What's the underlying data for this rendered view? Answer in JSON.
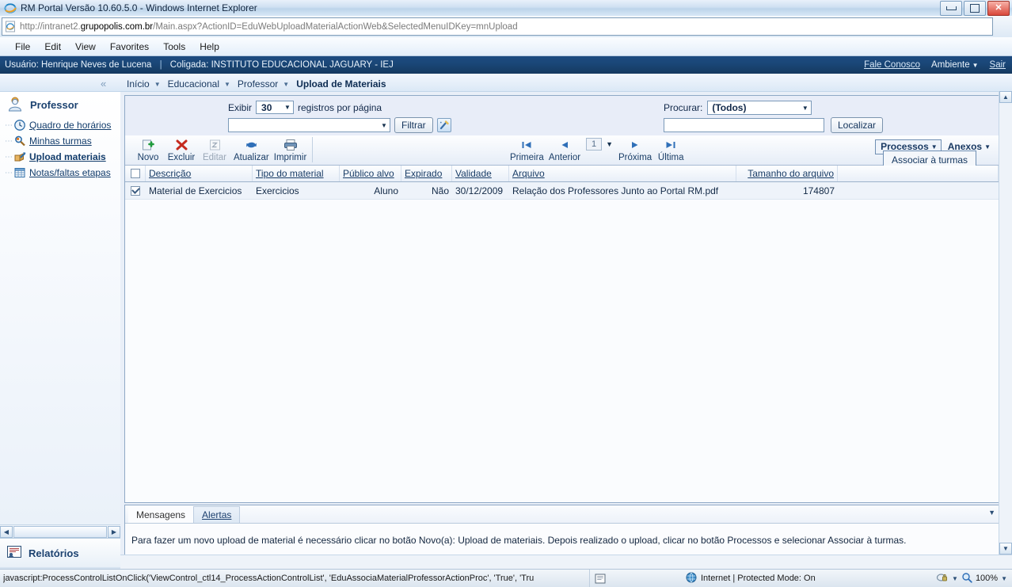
{
  "window": {
    "title": "RM Portal Versão 10.60.5.0 - Windows Internet Explorer",
    "minimize_label": "Minimize",
    "maximize_label": "Maximize",
    "close_label": "Close"
  },
  "address": {
    "protocol_host_prefix": "http://intranet2.",
    "host_bold": "grupopolis.com.br",
    "path": "/Main.aspx?ActionID=EduWebUploadMaterialActionWeb&SelectedMenuIDKey=mnUpload"
  },
  "menubar": {
    "items": [
      "File",
      "Edit",
      "View",
      "Favorites",
      "Tools",
      "Help"
    ]
  },
  "userbar": {
    "user_label": "Usuário: Henrique Neves de Lucena",
    "separator": "|",
    "coligada_label": "Coligada: INSTITUTO EDUCACIONAL JAGUARY - IEJ",
    "fale_conosco": "Fale Conosco",
    "ambiente": "Ambiente",
    "sair": "Sair"
  },
  "breadcrumb": {
    "items": [
      "Início",
      "Educacional",
      "Professor"
    ],
    "current": "Upload de Materiais"
  },
  "sidebar": {
    "title": "Professor",
    "items": [
      {
        "label": "Quadro de horários",
        "icon": "clock-icon",
        "active": false
      },
      {
        "label": "Minhas turmas",
        "icon": "classes-icon",
        "active": false
      },
      {
        "label": "Upload materiais",
        "icon": "upload-icon",
        "active": true
      },
      {
        "label": "Notas/faltas etapas",
        "icon": "grades-icon",
        "active": false
      }
    ],
    "reports_title": "Relatórios"
  },
  "filters": {
    "exibir_label": "Exibir",
    "exibir_value": "30",
    "registros_label": "registros por página",
    "filter_combo_value": "",
    "filtrar_button": "Filtrar",
    "wand_icon": "magic-wand-icon",
    "procurar_label": "Procurar:",
    "procurar_value": "(Todos)",
    "localizar_input_value": "",
    "localizar_button": "Localizar"
  },
  "toolbar": {
    "actions": [
      {
        "label": "Novo",
        "icon": "new-icon",
        "disabled": false
      },
      {
        "label": "Excluir",
        "icon": "delete-icon",
        "disabled": false
      },
      {
        "label": "Editar",
        "icon": "edit-icon",
        "disabled": true
      },
      {
        "label": "Atualizar",
        "icon": "refresh-icon",
        "disabled": false
      },
      {
        "label": "Imprimir",
        "icon": "print-icon",
        "disabled": false
      }
    ],
    "pager": [
      {
        "label": "Primeira",
        "icon": "first-page-icon"
      },
      {
        "label": "Anterior",
        "icon": "previous-page-icon"
      }
    ],
    "page_value": "1",
    "pager_next": [
      {
        "label": "Próxima",
        "icon": "next-page-icon"
      },
      {
        "label": "Última",
        "icon": "last-page-icon"
      }
    ],
    "processos_label": "Processos",
    "anexos_label": "Anexos",
    "processos_menu_item": "Associar à turmas"
  },
  "grid": {
    "columns": [
      "Descrição",
      "Tipo do material",
      "Público alvo",
      "Expirado",
      "Validade",
      "Arquivo",
      "Tamanho do arquivo"
    ],
    "rows": [
      {
        "selected": true,
        "descricao": "Material de Exercicios",
        "tipo": "Exercicios",
        "publico": "Aluno",
        "expirado": "Não",
        "validade": "30/12/2009",
        "arquivo": "Relação dos Professores Junto ao Portal RM.pdf",
        "tamanho": "174807"
      }
    ]
  },
  "messages": {
    "tabs": [
      {
        "label": "Mensagens",
        "selected": true
      },
      {
        "label": "Alertas",
        "selected": false
      }
    ],
    "body": "Para fazer um novo upload de material é necessário clicar no botão Novo(a): Upload de materiais. Depois realizado o upload, clicar no botão Processos e selecionar Associar à turmas."
  },
  "statusbar": {
    "js_text": "javascript:ProcessControlListOnClick('ViewControl_ctl14_ProcessActionControlList', 'EduAssociaMaterialProfessorActionProc', 'True', 'Tru",
    "zone_icon": "globe-icon",
    "zone_text": "Internet | Protected Mode: On",
    "zoom_icon": "zoom-icon",
    "zoom_value": "100%"
  }
}
